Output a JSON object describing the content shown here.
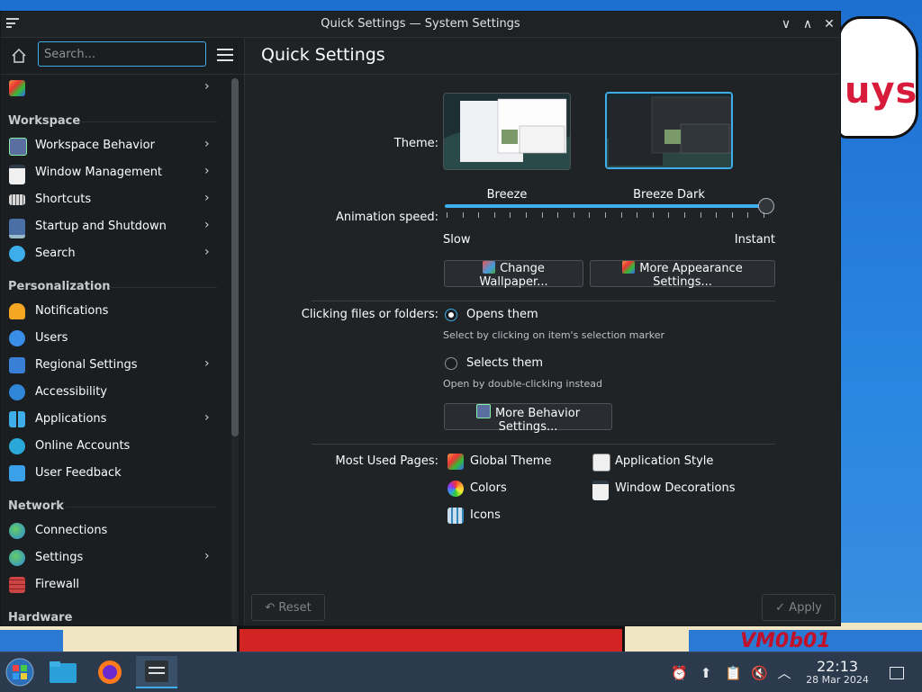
{
  "window": {
    "title": "Quick Settings — System Settings",
    "controls": {
      "minimize": "∨",
      "maximize": "∧",
      "close": "✕"
    }
  },
  "sidebar": {
    "search_placeholder": "Search...",
    "top_item": {
      "label": "",
      "icon": "appearance-icon"
    },
    "sections": [
      {
        "title": "Workspace",
        "items": [
          {
            "label": "Workspace Behavior",
            "icon": "workspace-behavior-icon",
            "chevron": true
          },
          {
            "label": "Window Management",
            "icon": "window-management-icon",
            "chevron": true
          },
          {
            "label": "Shortcuts",
            "icon": "keyboard-icon",
            "chevron": true
          },
          {
            "label": "Startup and Shutdown",
            "icon": "startup-icon",
            "chevron": true
          },
          {
            "label": "Search",
            "icon": "search-icon",
            "chevron": true
          }
        ]
      },
      {
        "title": "Personalization",
        "items": [
          {
            "label": "Notifications",
            "icon": "bell-icon",
            "chevron": false
          },
          {
            "label": "Users",
            "icon": "users-icon",
            "chevron": false
          },
          {
            "label": "Regional Settings",
            "icon": "regional-icon",
            "chevron": true
          },
          {
            "label": "Accessibility",
            "icon": "accessibility-icon",
            "chevron": false
          },
          {
            "label": "Applications",
            "icon": "applications-icon",
            "chevron": true
          },
          {
            "label": "Online Accounts",
            "icon": "online-accounts-icon",
            "chevron": false
          },
          {
            "label": "User Feedback",
            "icon": "feedback-icon",
            "chevron": false
          }
        ]
      },
      {
        "title": "Network",
        "items": [
          {
            "label": "Connections",
            "icon": "globe-icon",
            "chevron": false
          },
          {
            "label": "Settings",
            "icon": "network-settings-icon",
            "chevron": true
          },
          {
            "label": "Firewall",
            "icon": "firewall-icon",
            "chevron": false
          }
        ]
      },
      {
        "title": "Hardware",
        "items": []
      }
    ]
  },
  "main": {
    "page_title": "Quick Settings",
    "theme": {
      "label": "Theme:",
      "options": [
        {
          "name": "Breeze",
          "selected": false
        },
        {
          "name": "Breeze Dark",
          "selected": true
        }
      ]
    },
    "animation": {
      "label": "Animation speed:",
      "min_label": "Slow",
      "max_label": "Instant",
      "value_fraction": 1.0
    },
    "buttons": {
      "change_wallpaper": "Change Wallpaper...",
      "more_appearance": "More Appearance Settings...",
      "more_behavior": "More Behavior Settings..."
    },
    "clicking": {
      "label": "Clicking files or folders:",
      "options": [
        {
          "label": "Opens them",
          "hint": "Select by clicking on item's selection marker",
          "checked": true
        },
        {
          "label": "Selects them",
          "hint": "Open by double-clicking instead",
          "checked": false
        }
      ]
    },
    "most_used": {
      "label": "Most Used Pages:",
      "items": [
        {
          "label": "Global Theme",
          "icon": "global-theme-icon"
        },
        {
          "label": "Application Style",
          "icon": "application-style-icon"
        },
        {
          "label": "Colors",
          "icon": "colors-icon"
        },
        {
          "label": "Window Decorations",
          "icon": "window-decorations-icon"
        },
        {
          "label": "Icons",
          "icon": "icons-icon"
        }
      ]
    },
    "footer": {
      "reset": "Reset",
      "apply": "Apply"
    }
  },
  "taskbar": {
    "apps": [
      "application-launcher",
      "file-manager",
      "firefox",
      "system-settings"
    ],
    "time": "22:13",
    "date": "28 Mar 2024"
  },
  "desktop": {
    "bubble_text": "uys",
    "stamp_text": "VM0b01"
  },
  "colors": {
    "accent": "#3daee9",
    "window_bg": "#202326",
    "sidebar_bg": "#1b1e20",
    "taskbar_bg": "#2b3a4d"
  }
}
